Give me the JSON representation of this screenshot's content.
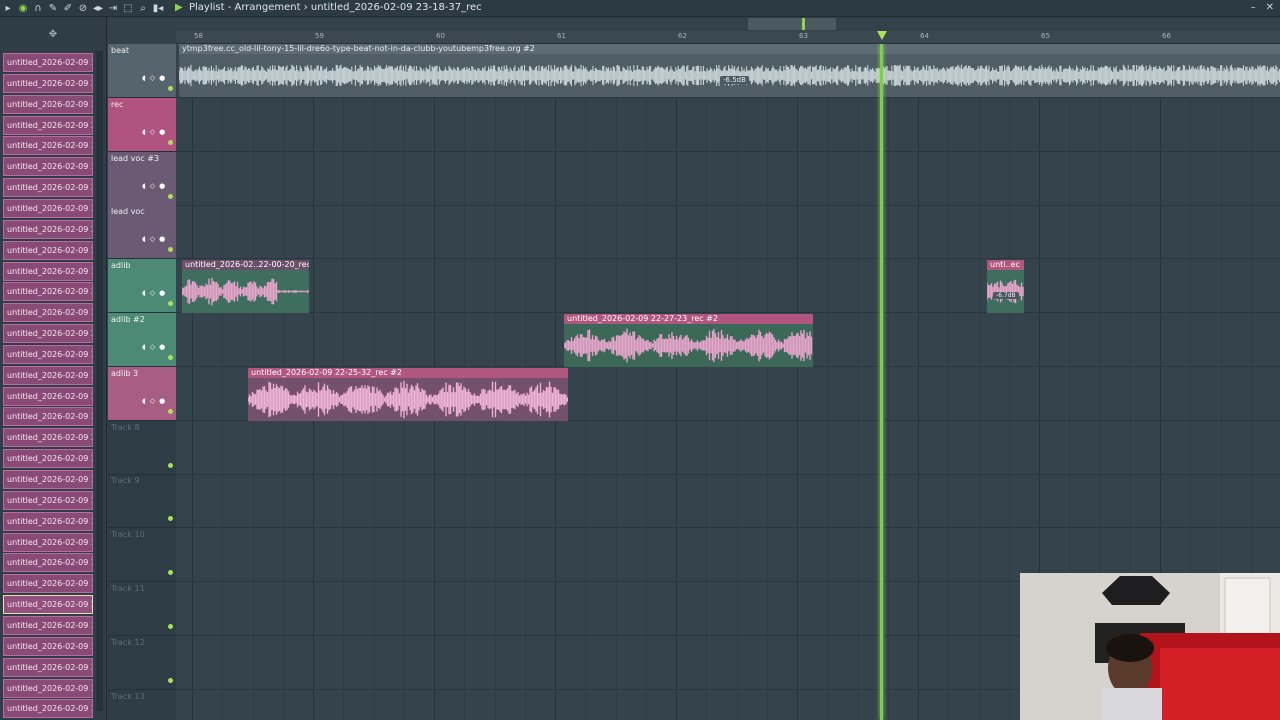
{
  "window": {
    "title": "Playlist - Arrangement",
    "project": "untitled_2026-02-09 23-18-37_rec"
  },
  "toolbar_icons": [
    "record-icon",
    "loop-icon",
    "pencil-icon",
    "paint-icon",
    "delete-icon",
    "mute-icon",
    "slip-icon",
    "select-icon",
    "zoom-icon",
    "playback-icon",
    "speaker-icon"
  ],
  "browser": {
    "items": [
      "untitled_2026-02-09 23-...",
      "untitled_2026-02-09 23-...",
      "untitled_2026-02-09 23-...",
      "untitled_2026-02-09 23-...",
      "untitled_2026-02-09 23-...",
      "untitled_2026-02-09 23-...",
      "untitled_2026-02-09 23-...",
      "untitled_2026-02-09 23-...",
      "untitled_2026-02-09 23-...",
      "untitled_2026-02-09 23-...",
      "untitled_2026-02-09 23-...",
      "untitled_2026-02-09 23-...",
      "untitled_2026-02-09 23-...",
      "untitled_2026-02-09 23-...",
      "untitled_2026-02-09 23-...",
      "untitled_2026-02-09 23-...",
      "untitled_2026-02-09 23-...",
      "untitled_2026-02-09 23-...",
      "untitled_2026-02-09 23-...",
      "untitled_2026-02-09 23-...",
      "untitled_2026-02-09 23-...",
      "untitled_2026-02-09 23-...",
      "untitled_2026-02-09 23-...",
      "untitled_2026-02-09 23-...",
      "untitled_2026-02-09 23-...",
      "untitled_2026-02-09 23-...",
      "untitled_2026-02-09 23-...",
      "untitled_2026-02-09 23-...",
      "untitled_2026-02-09 23-...",
      "untitled_2026-02-09 23-...",
      "untitled_2026-02-09 23-...",
      "untitled_2026-02-09 23-...",
      "untitled_2026-02-09 23-..."
    ],
    "selected_index": 26
  },
  "ruler": {
    "ticks": [
      "58",
      "59",
      "60",
      "61",
      "62",
      "63",
      "64",
      "65",
      "66"
    ]
  },
  "tracks": [
    {
      "name": "beat"
    },
    {
      "name": "rec"
    },
    {
      "name": "lead voc #3"
    },
    {
      "name": "lead voc"
    },
    {
      "name": "adlib"
    },
    {
      "name": "adlib #2"
    },
    {
      "name": "adlib 3"
    },
    {
      "name": "Track 8"
    },
    {
      "name": "Track 9"
    },
    {
      "name": "Track 10"
    },
    {
      "name": "Track 11"
    },
    {
      "name": "Track 12"
    },
    {
      "name": "Track 13"
    }
  ],
  "clips": {
    "beat": {
      "title": "ytmp3free.cc_old-lil-tony-15-lil-dre6o-type-beat-not-in-da-clubb-youtubemp3free.org #2",
      "db": "-6.5dB"
    },
    "adlib": {
      "title": "untitled_2026-02..22-00-20_rec #2"
    },
    "adlib2": {
      "title": "untitled_2026-02-09 22-27-23_rec #2"
    },
    "adlib3": {
      "title": "untitled_2026-02-09 22-25-32_rec #2"
    },
    "small": {
      "title": "unti..ec",
      "db": "-6.7dB"
    }
  }
}
